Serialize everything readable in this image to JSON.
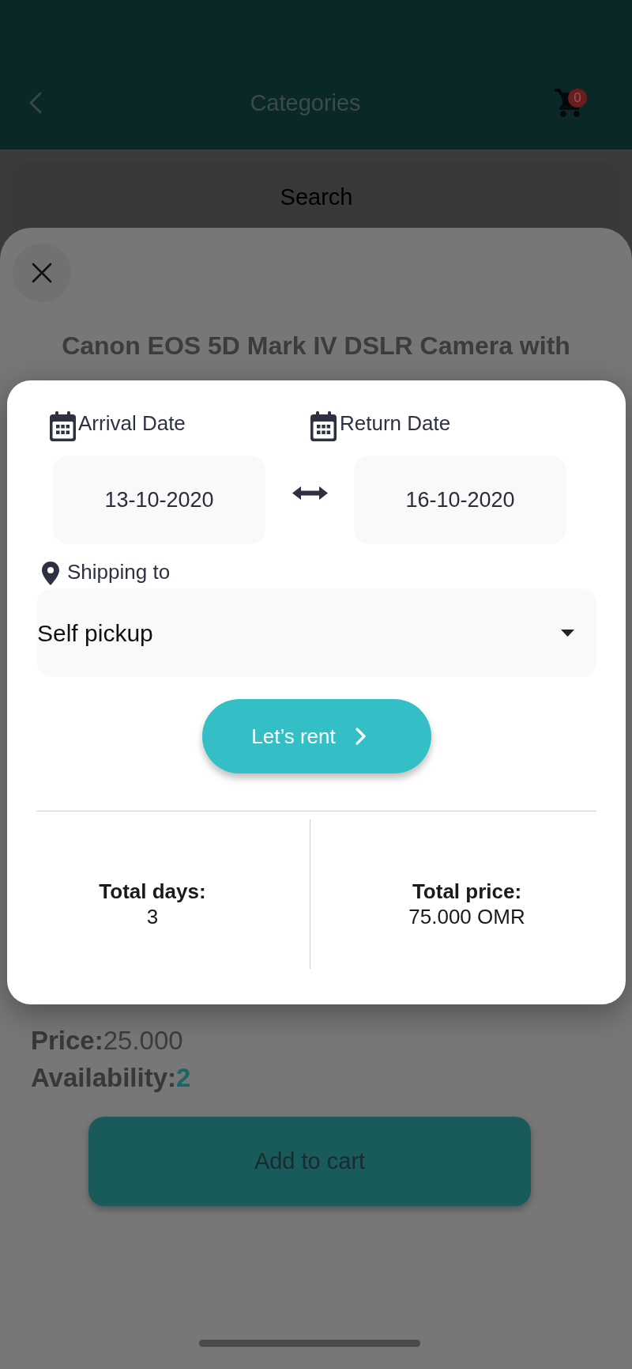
{
  "header": {
    "title": "Categories",
    "cart_count": "0"
  },
  "search": {
    "placeholder": "Search"
  },
  "product_sheet": {
    "title": "Canon EOS 5D Mark IV DSLR Camera with",
    "price_label": "Price:",
    "price": "25.000",
    "availability_label": "Availability:",
    "availability": "2",
    "add_to_cart": "Add to cart"
  },
  "rent_dialog": {
    "arrival": {
      "label": "Arrival Date",
      "value": "13-10-2020"
    },
    "return": {
      "label": "Return Date",
      "value": "16-10-2020"
    },
    "shipping": {
      "label": "Shipping to",
      "value": "Self pickup"
    },
    "rent_button": "Let’s rent",
    "totals": [
      {
        "label": "Total days:",
        "value": "3"
      },
      {
        "label": "Total price:",
        "value": "75.000 OMR"
      }
    ]
  }
}
